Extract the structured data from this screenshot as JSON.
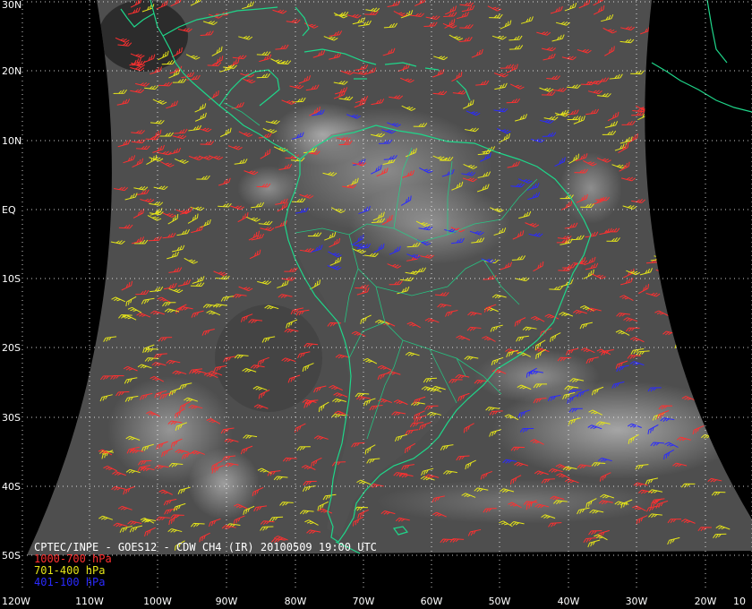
{
  "map": {
    "caption": "CPTEC/INPE - GOES12 - CDW CH4 (IR) 20100509 19:00 UTC",
    "lat_labels": [
      "30N",
      "20N",
      "10N",
      "EQ",
      "10S",
      "20S",
      "30S",
      "40S",
      "50S"
    ],
    "lon_labels": [
      "120W",
      "110W",
      "100W",
      "90W",
      "80W",
      "70W",
      "60W",
      "50W",
      "40W",
      "30W",
      "20W",
      "10"
    ],
    "legend": [
      {
        "label": "1000-700 hPa",
        "color": "#ff3030"
      },
      {
        "label": "701-400 hPa",
        "color": "#e6e619"
      },
      {
        "label": "401-100 hPa",
        "color": "#2a2aff"
      }
    ],
    "coast_color": "#1fd68a",
    "grid_color": "#ffffff"
  }
}
